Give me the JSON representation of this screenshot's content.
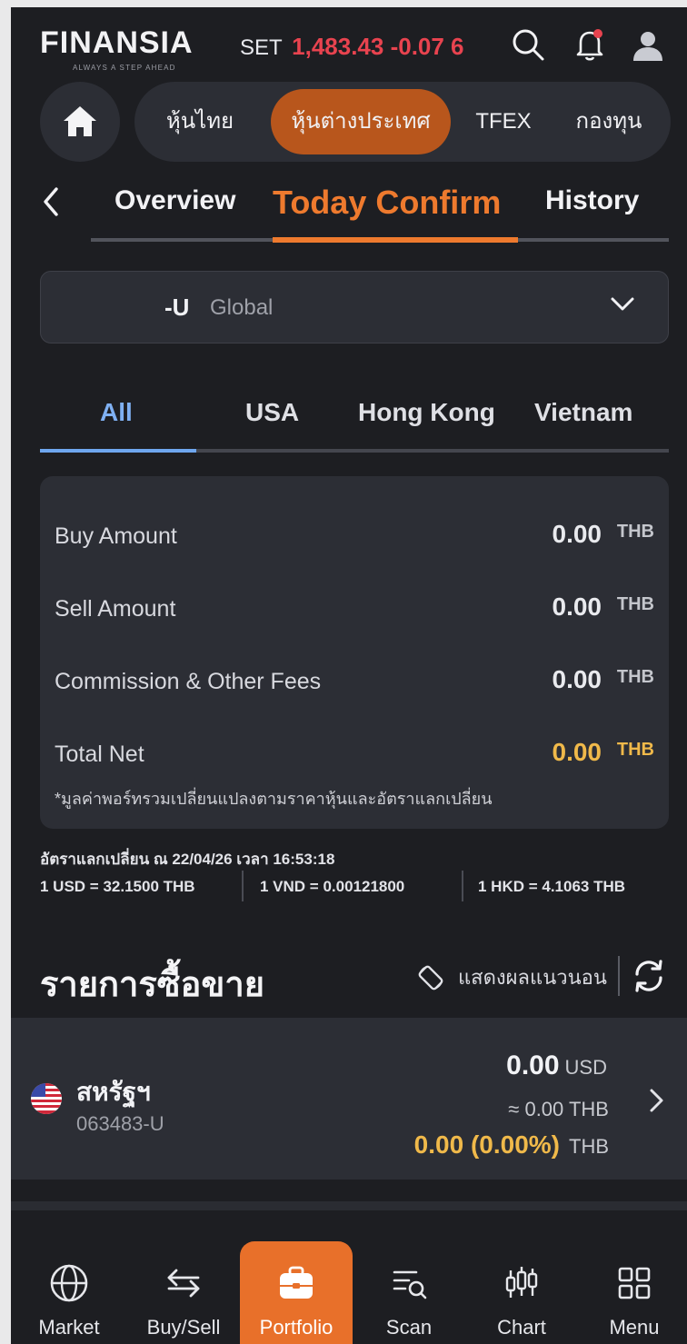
{
  "header": {
    "logo_text": "FINANSIA",
    "logo_tagline": "ALWAYS A STEP AHEAD",
    "index_name": "SET",
    "index_value": "1,483.43 -0.07 6"
  },
  "categories": [
    {
      "label": "หุ้นไทย"
    },
    {
      "label": "หุ้นต่างประเทศ"
    },
    {
      "label": "TFEX"
    },
    {
      "label": "กองทุน"
    }
  ],
  "sub_tabs": [
    {
      "label": "Overview"
    },
    {
      "label": "Today Confirm"
    },
    {
      "label": "History"
    }
  ],
  "account": {
    "id": "-U",
    "type": "Global"
  },
  "market_tabs": [
    {
      "label": "All"
    },
    {
      "label": "USA"
    },
    {
      "label": "Hong Kong"
    },
    {
      "label": "Vietnam"
    }
  ],
  "summary": {
    "rows": [
      {
        "label": "Buy Amount",
        "amount": "0.00",
        "currency": "THB"
      },
      {
        "label": "Sell Amount",
        "amount": "0.00",
        "currency": "THB"
      },
      {
        "label": "Commission & Other Fees",
        "amount": "0.00",
        "currency": "THB"
      },
      {
        "label": "Total Net",
        "amount": "0.00",
        "currency": "THB"
      }
    ],
    "note": "*มูลค่าพอร์ทรวมเปลี่ยนแปลงตามราคาหุ้นและอัตราแลกเปลี่ยน"
  },
  "exchange": {
    "title": "อัตราแลกเปลี่ยน ณ 22/04/26 เวลา 16:53:18",
    "rates": [
      "1 USD = 32.1500 THB",
      "1 VND = 0.00121800",
      "1 HKD = 4.1063 THB"
    ]
  },
  "transactions": {
    "title": "รายการซื้อขาย",
    "landscape_label": "แสดงผลแนวนอน",
    "item": {
      "name": "สหรัฐฯ",
      "account": "063483-U",
      "value": "0.00",
      "value_currency": "USD",
      "thb_value": "≈ 0.00  THB",
      "pl": "0.00 (0.00%)",
      "pl_currency": "THB"
    }
  },
  "nav": [
    {
      "label": "Market",
      "icon": "globe-icon"
    },
    {
      "label": "Buy/Sell",
      "icon": "swap-arrows-icon"
    },
    {
      "label": "Portfolio",
      "icon": "briefcase-icon"
    },
    {
      "label": "Scan",
      "icon": "scan-list-icon"
    },
    {
      "label": "Chart",
      "icon": "candlestick-icon"
    },
    {
      "label": "Menu",
      "icon": "grid-icon"
    }
  ],
  "colors": {
    "accent_orange": "#ee7a2e",
    "active_blue": "#7fb0f2",
    "negative_red": "#e8434f",
    "total_gold": "#f0b94a",
    "background": "#1d1e22",
    "card": "#2c2e35"
  }
}
